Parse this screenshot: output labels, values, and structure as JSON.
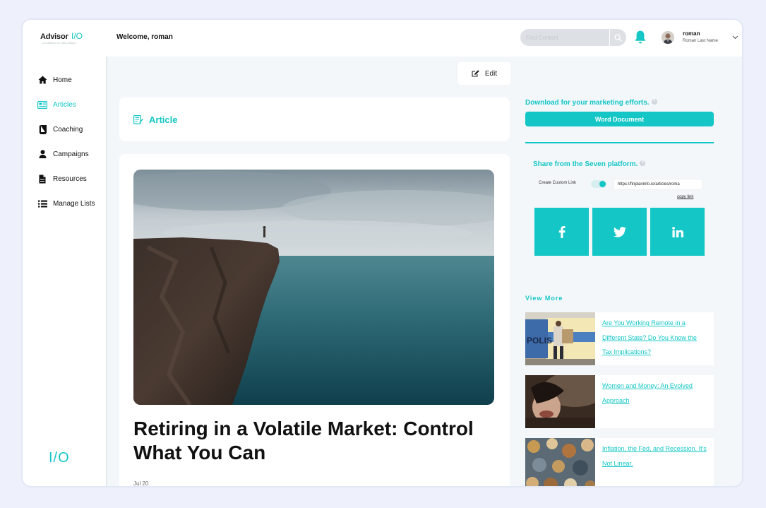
{
  "header": {
    "logo_word": "Advisor",
    "logo_io": "I/O",
    "logo_tagline": "A COMPANY OF FINPLANINFO",
    "welcome": "Welcome, roman",
    "search_placeholder": "Find Content",
    "user_name": "roman",
    "user_full": "Roman Last Name"
  },
  "sidebar": {
    "items": [
      {
        "label": "Home",
        "icon": "home-icon"
      },
      {
        "label": "Articles",
        "icon": "newspaper-icon"
      },
      {
        "label": "Coaching",
        "icon": "book-icon"
      },
      {
        "label": "Campaigns",
        "icon": "user-icon"
      },
      {
        "label": "Resources",
        "icon": "file-icon"
      },
      {
        "label": "Manage Lists",
        "icon": "list-icon"
      }
    ],
    "active": "Articles",
    "footer_logo": "I/O"
  },
  "main": {
    "edit_label": "Edit",
    "section_label": "Article",
    "article_title": "Retiring in a Volatile Market: Control What You Can",
    "article_date": "Jul 20"
  },
  "right": {
    "download_title": "Download for your marketing efforts.",
    "word_button": "Word Document",
    "share_title": "Share from the Seven platform.",
    "custom_link_label": "Create Custom Link",
    "custom_link_on": true,
    "link_url": "https://finplaninfo.io/articles/roma",
    "copy_link": "copy link",
    "social": [
      {
        "label": "f",
        "icon": "facebook-icon"
      },
      {
        "label": "twitter",
        "icon": "twitter-icon"
      },
      {
        "label": "in",
        "icon": "linkedin-icon"
      }
    ],
    "view_more_title": "View More",
    "view_more": [
      {
        "title": "Are You Working Remote in a Different State? Do You Know the Tax Implications?"
      },
      {
        "title": "Women and Money: An Evolved Approach"
      },
      {
        "title": "Inflation, the Fed, and Recession. It's Not Linear."
      }
    ]
  },
  "colors": {
    "accent": "#15c6c6",
    "background": "#f4f7fa",
    "text": "#111111"
  }
}
